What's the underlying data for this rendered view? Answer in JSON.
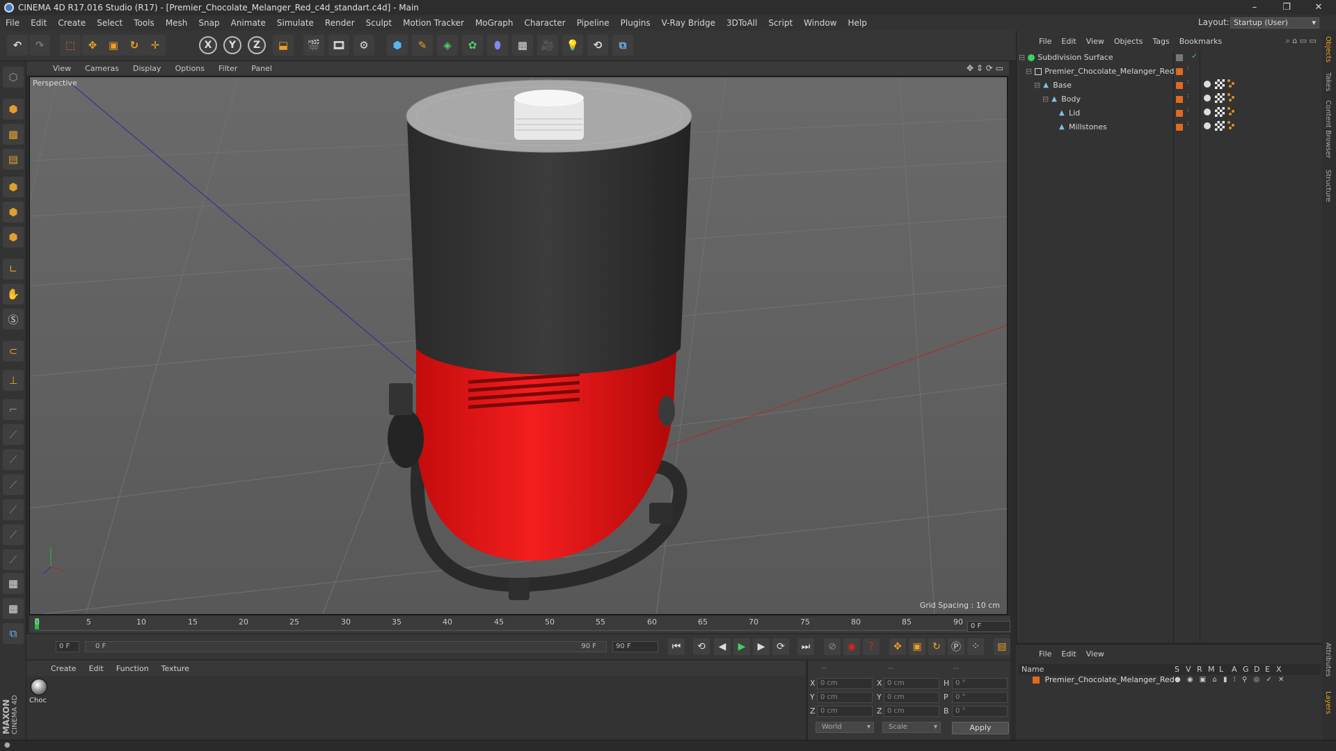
{
  "titlebar": {
    "title": "CINEMA 4D R17.016 Studio (R17) - [Premier_Chocolate_Melanger_Red_c4d_standart.c4d] - Main",
    "minimize": "–",
    "maximize": "❐",
    "close": "✕"
  },
  "menubar": {
    "items": [
      "File",
      "Edit",
      "Create",
      "Select",
      "Tools",
      "Mesh",
      "Snap",
      "Animate",
      "Simulate",
      "Render",
      "Sculpt",
      "Motion Tracker",
      "MoGraph",
      "Character",
      "Pipeline",
      "Plugins",
      "V-Ray Bridge",
      "3DToAll",
      "Script",
      "Window",
      "Help"
    ],
    "layout_label": "Layout:",
    "layout_value": "Startup (User)"
  },
  "toolbar": {
    "axis_x": "X",
    "axis_y": "Y",
    "axis_z": "Z"
  },
  "viewport": {
    "menu": [
      "View",
      "Cameras",
      "Display",
      "Options",
      "Filter",
      "Panel"
    ],
    "label": "Perspective",
    "grid_spacing": "Grid Spacing : 10 cm"
  },
  "timeline": {
    "ticks": [
      "0",
      "5",
      "10",
      "15",
      "20",
      "25",
      "30",
      "35",
      "40",
      "45",
      "50",
      "55",
      "60",
      "65",
      "70",
      "75",
      "80",
      "85",
      "90"
    ],
    "current_frame": "0 F"
  },
  "transport": {
    "start_field": "0 F",
    "range_start": "0 F",
    "range_end": "90 F",
    "end_field": "90 F"
  },
  "material_manager": {
    "menu": [
      "Create",
      "Edit",
      "Function",
      "Texture"
    ],
    "materials": [
      {
        "name": "Choc"
      }
    ]
  },
  "maxon": {
    "line1": "MAXON",
    "line2": "CINEMA 4D"
  },
  "coordinates": {
    "headers": [
      "--",
      "--",
      "--"
    ],
    "rows": [
      {
        "a": "X",
        "a_val": "0 cm",
        "b": "X",
        "b_val": "0 cm",
        "c": "H",
        "c_val": "0 °"
      },
      {
        "a": "Y",
        "a_val": "0 cm",
        "b": "Y",
        "b_val": "0 cm",
        "c": "P",
        "c_val": "0 °"
      },
      {
        "a": "Z",
        "a_val": "0 cm",
        "b": "Z",
        "b_val": "0 cm",
        "c": "B",
        "c_val": "0 °"
      }
    ],
    "space": "World",
    "mode": "Scale",
    "apply": "Apply"
  },
  "object_manager": {
    "menu": [
      "File",
      "Edit",
      "View",
      "Objects",
      "Tags",
      "Bookmarks"
    ],
    "objects": [
      {
        "name": "Subdivision Surface",
        "icon": "subdivision-icon"
      },
      {
        "name": "Premier_Chocolate_Melanger_Red",
        "icon": "null-icon"
      },
      {
        "name": "Base",
        "icon": "polygon-icon"
      },
      {
        "name": "Body",
        "icon": "polygon-icon"
      },
      {
        "name": "Lid",
        "icon": "polygon-icon"
      },
      {
        "name": "Millstones",
        "icon": "polygon-icon"
      }
    ]
  },
  "layer_manager": {
    "menu": [
      "File",
      "Edit",
      "View"
    ],
    "columns": [
      "Name",
      "S",
      "V",
      "R",
      "M",
      "L",
      "A",
      "G",
      "D",
      "E",
      "X"
    ],
    "layers": [
      {
        "name": "Premier_Chocolate_Melanger_Red"
      }
    ]
  },
  "right_tabs": [
    "Objects",
    "Takes",
    "Content Browser",
    "Structure",
    "Attributes",
    "Layers"
  ],
  "colors": {
    "accent_orange": "#e06a20",
    "body_red": "#e61414",
    "viewport_bg": "#5e5e5e",
    "selection_green": "#2fb84a"
  }
}
